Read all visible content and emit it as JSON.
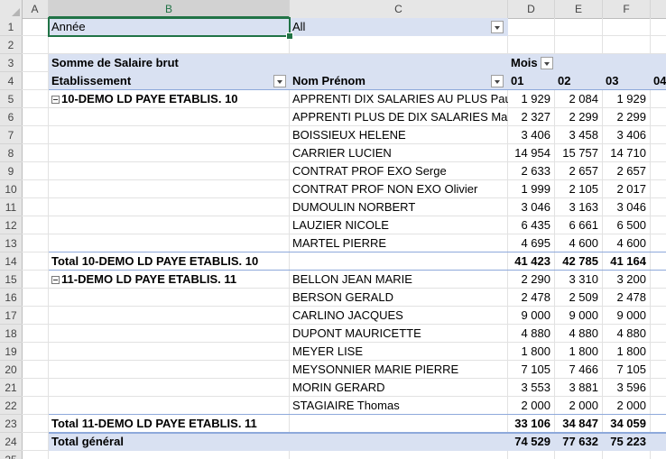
{
  "columns": [
    "A",
    "B",
    "C",
    "D",
    "E",
    "F"
  ],
  "row_numbers": [
    "1",
    "2",
    "3",
    "4",
    "5",
    "6",
    "7",
    "8",
    "9",
    "10",
    "11",
    "12",
    "13",
    "14",
    "15",
    "16",
    "17",
    "18",
    "19",
    "20",
    "21",
    "22",
    "23",
    "24",
    "25"
  ],
  "filter": {
    "label": "Année",
    "value": "All"
  },
  "pivot": {
    "value_field": "Somme de Salaire brut",
    "col_field": "Mois",
    "row_field_1": "Etablissement",
    "row_field_2": "Nom Prénom",
    "month_headers": [
      "01",
      "02",
      "03",
      "04"
    ]
  },
  "groups": [
    {
      "name": "10-DEMO LD PAYE ETABLIS. 10",
      "rows": [
        {
          "name": "APPRENTI DIX SALARIES AU PLUS Paul",
          "v": [
            "1 929",
            "2 084",
            "1 929"
          ]
        },
        {
          "name": "APPRENTI PLUS DE DIX SALARIES Marc",
          "v": [
            "2 327",
            "2 299",
            "2 299"
          ]
        },
        {
          "name": "BOISSIEUX HELENE",
          "v": [
            "3 406",
            "3 458",
            "3 406"
          ]
        },
        {
          "name": "CARRIER LUCIEN",
          "v": [
            "14 954",
            "15 757",
            "14 710"
          ]
        },
        {
          "name": "CONTRAT PROF EXO Serge",
          "v": [
            "2 633",
            "2 657",
            "2 657"
          ]
        },
        {
          "name": "CONTRAT PROF NON EXO Olivier",
          "v": [
            "1 999",
            "2 105",
            "2 017"
          ]
        },
        {
          "name": "DUMOULIN NORBERT",
          "v": [
            "3 046",
            "3 163",
            "3 046"
          ]
        },
        {
          "name": "LAUZIER NICOLE",
          "v": [
            "6 435",
            "6 661",
            "6 500"
          ]
        },
        {
          "name": "MARTEL PIERRE",
          "v": [
            "4 695",
            "4 600",
            "4 600"
          ]
        }
      ],
      "total_label": "Total 10-DEMO LD PAYE ETABLIS. 10",
      "total": [
        "41 423",
        "42 785",
        "41 164"
      ]
    },
    {
      "name": "11-DEMO LD PAYE ETABLIS. 11",
      "rows": [
        {
          "name": "BELLON JEAN MARIE",
          "v": [
            "2 290",
            "3 310",
            "3 200"
          ]
        },
        {
          "name": "BERSON GERALD",
          "v": [
            "2 478",
            "2 509",
            "2 478"
          ]
        },
        {
          "name": "CARLINO JACQUES",
          "v": [
            "9 000",
            "9 000",
            "9 000"
          ]
        },
        {
          "name": "DUPONT MAURICETTE",
          "v": [
            "4 880",
            "4 880",
            "4 880"
          ]
        },
        {
          "name": "MEYER LISE",
          "v": [
            "1 800",
            "1 800",
            "1 800"
          ]
        },
        {
          "name": "MEYSONNIER MARIE PIERRE",
          "v": [
            "7 105",
            "7 466",
            "7 105"
          ]
        },
        {
          "name": "MORIN GERARD",
          "v": [
            "3 553",
            "3 881",
            "3 596"
          ]
        },
        {
          "name": "STAGIAIRE Thomas",
          "v": [
            "2 000",
            "2 000",
            "2 000"
          ]
        }
      ],
      "total_label": "Total 11-DEMO LD PAYE ETABLIS. 11",
      "total": [
        "33 106",
        "34 847",
        "34 059"
      ]
    }
  ],
  "grand_total": {
    "label": "Total général",
    "values": [
      "74 529",
      "77 632",
      "75 223"
    ]
  },
  "colors": {
    "header_band": "#d9e1f2",
    "separator": "#8ea9db",
    "selection": "#217346"
  }
}
